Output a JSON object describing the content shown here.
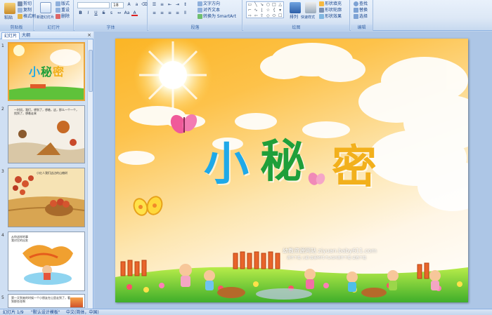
{
  "ribbon": {
    "clipboard": {
      "paste": "粘贴",
      "cut": "剪切",
      "copy": "复制",
      "format_painter": "格式刷",
      "label": "剪贴板"
    },
    "slides": {
      "new_slide": "新建幻灯片",
      "layout": "版式",
      "reset": "重设",
      "delete": "删除",
      "label": "幻灯片"
    },
    "font": {
      "font_size": "18",
      "label": "字体"
    },
    "paragraph": {
      "text_direction": "文字方向",
      "align_text": "对齐文本",
      "smartart": "转换为 SmartArt",
      "label": "段落"
    },
    "drawing": {
      "arrange": "排列",
      "quick_styles": "快速样式",
      "shape_fill": "形状填充",
      "shape_outline": "形状轮廓",
      "shape_effects": "形状效果",
      "label": "绘图"
    },
    "editing": {
      "find": "查找",
      "replace": "替换",
      "select": "选择",
      "label": "编辑"
    }
  },
  "panel": {
    "tabs": [
      "幻灯片",
      "大纲"
    ],
    "close": "×",
    "slide_numbers": [
      "1",
      "2",
      "3",
      "4",
      "5"
    ],
    "thumb2_text": "一时间，我们，想到了，想着，这，那么一个一个，找到了，想着走来",
    "thumb3_text": "小红人我们这边的山楂树",
    "thumb4_text": "从你这样的事\n我对它的出发",
    "thumb5_text": "第一天到来的时候一个小朋友在山里走到了，看到那些花啊"
  },
  "slide": {
    "title_chars": [
      "小",
      "秘",
      "密"
    ],
    "title_colors": [
      "#1fa9e8",
      "#1f9f3a",
      "#f2b01c"
    ],
    "watermark_line1": "幼教资源网站  ziyuan.baby611.com",
    "watermark_line2": "课件下载  儿歌  故事MP3  FLASH课件下载  试卷下载"
  },
  "status": {
    "slide_info": "幻灯片 1/9",
    "theme": "\"默认设计模板\"",
    "language": "中文(简体，中国)"
  }
}
